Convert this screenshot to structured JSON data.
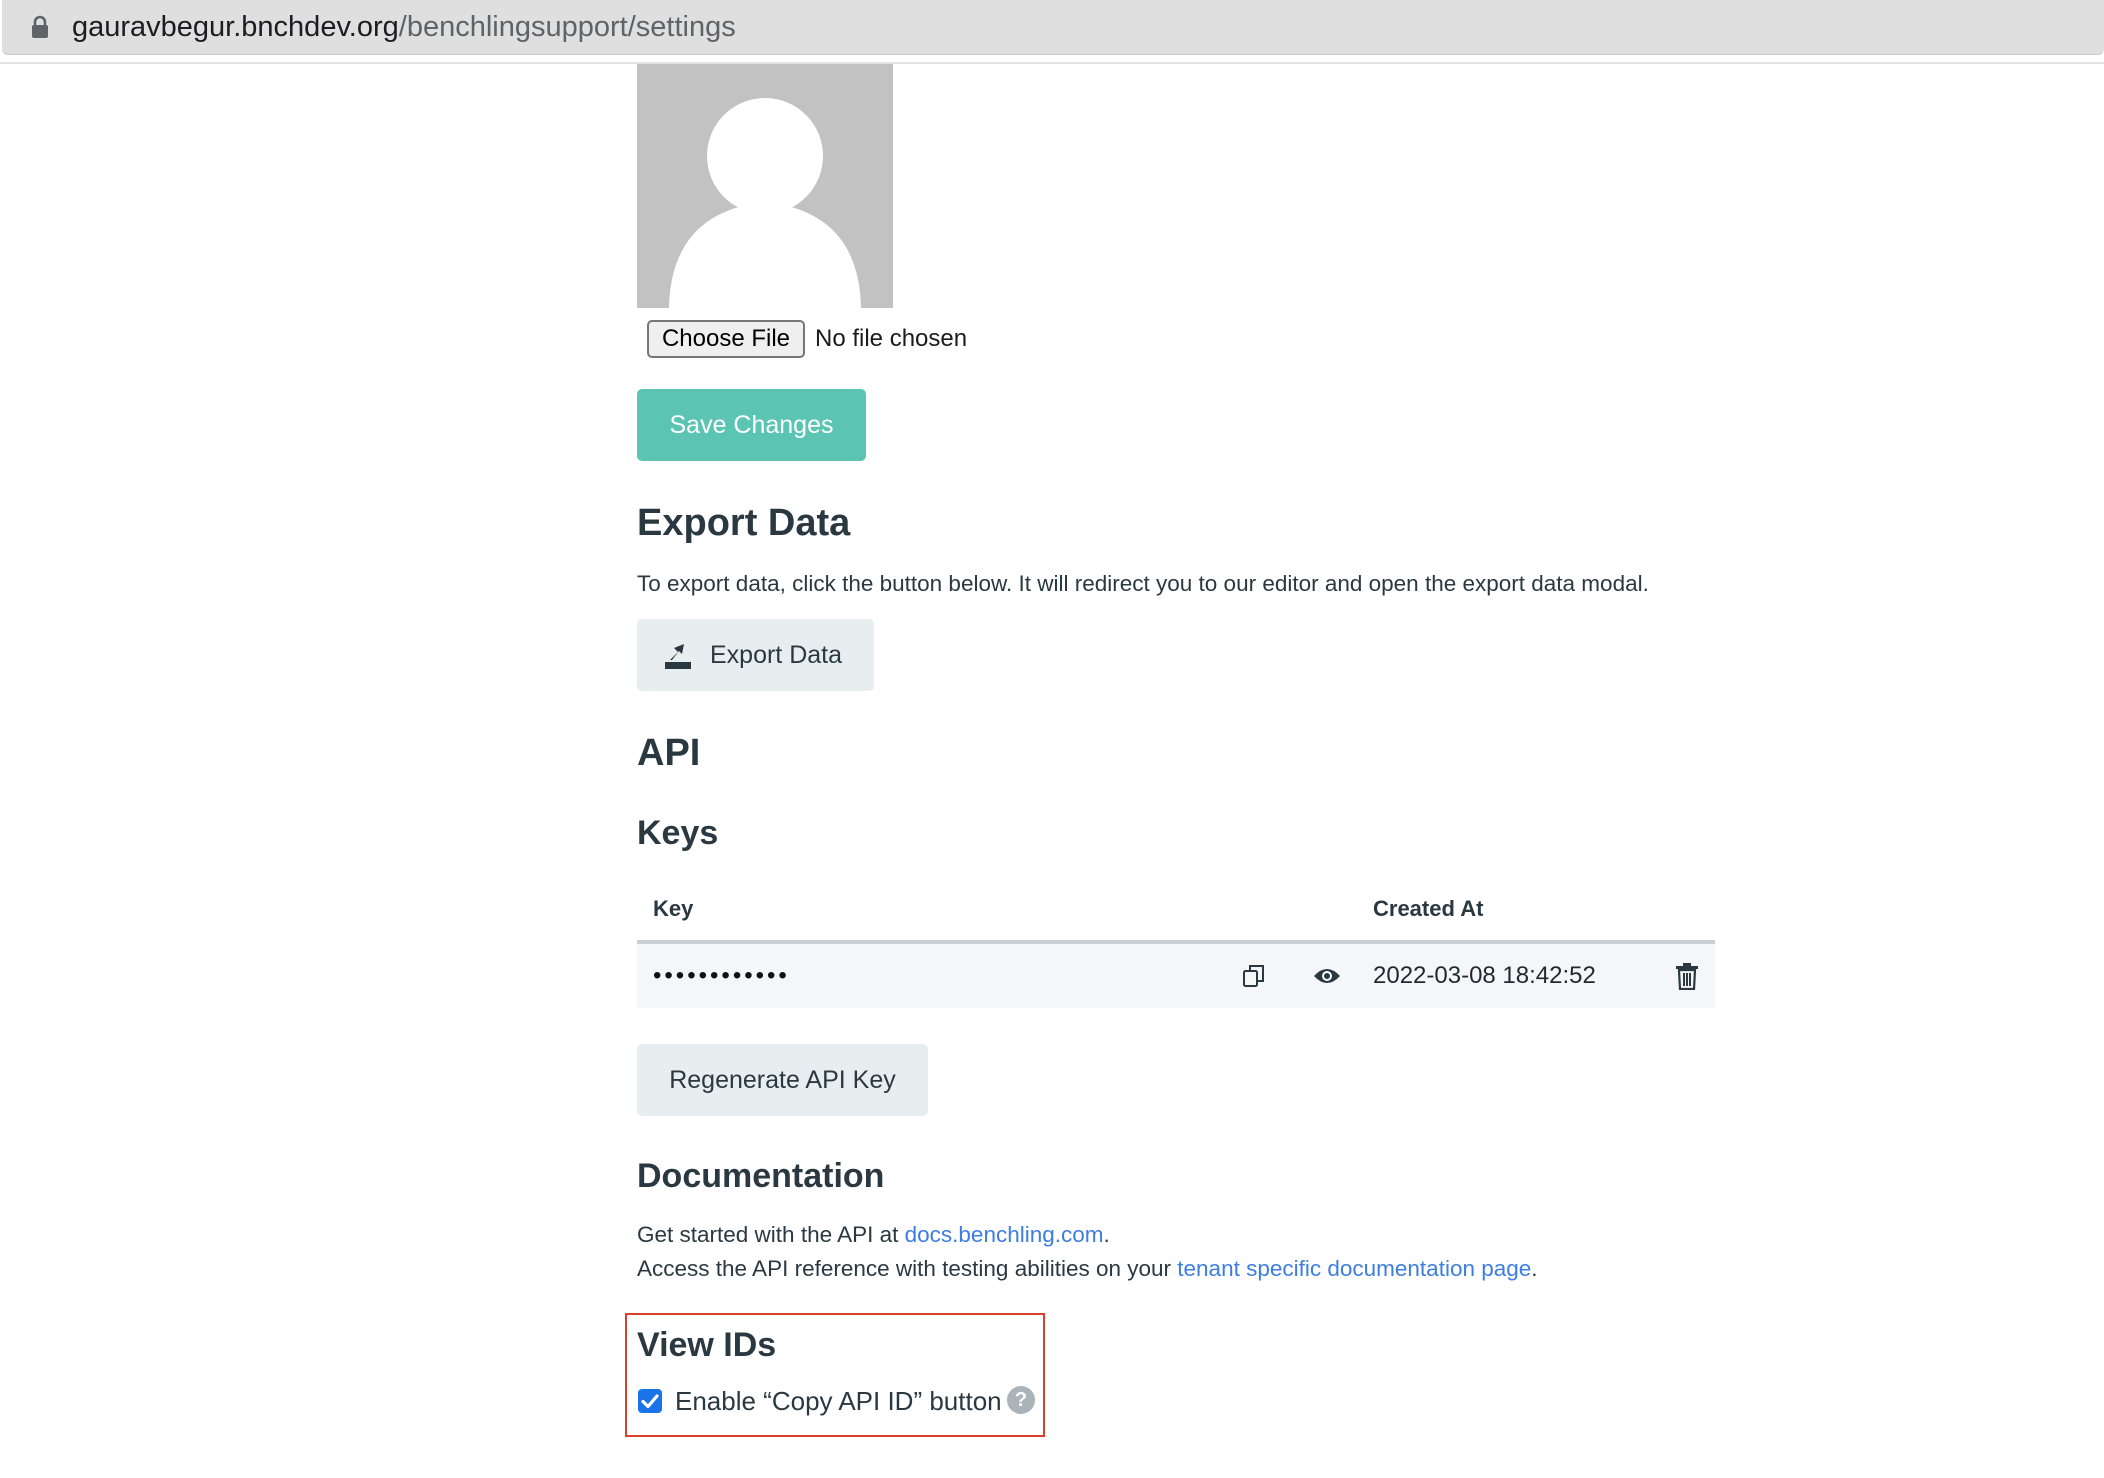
{
  "browser": {
    "url_host": "gauravbegur.bnchdev.org",
    "url_path": "/benchlingsupport/settings"
  },
  "profile": {
    "file_button_label": "Choose File",
    "file_status": "No file chosen",
    "save_label": "Save Changes"
  },
  "export": {
    "title": "Export Data",
    "description": "To export data, click the button below. It will redirect you to our editor and open the export data modal.",
    "button_label": "Export Data",
    "button_icon": "export-icon"
  },
  "api": {
    "title": "API",
    "keys_title": "Keys",
    "columns": [
      "Key",
      "Created At"
    ],
    "rows": [
      {
        "key_masked": "••••••••••••",
        "created_at": "2022-03-08 18:42:52"
      }
    ],
    "row_icons": [
      "copy-icon",
      "eye-icon",
      "trash-icon"
    ],
    "regenerate_label": "Regenerate API Key"
  },
  "docs": {
    "title": "Documentation",
    "line1_prefix": "Get started with the API at ",
    "line1_link": "docs.benchling.com",
    "line1_suffix": ".",
    "line2_prefix": "Access the API reference with testing abilities on your ",
    "line2_link": "tenant specific documentation page",
    "line2_suffix": "."
  },
  "view_ids": {
    "title": "View IDs",
    "checkbox_label": "Enable “Copy API ID” button",
    "checked": true,
    "help_glyph": "?"
  },
  "colors": {
    "primary": "#5bc4b3",
    "link": "#3d7ee0",
    "highlight_border": "#d9412b",
    "checkbox": "#1a73e8"
  }
}
